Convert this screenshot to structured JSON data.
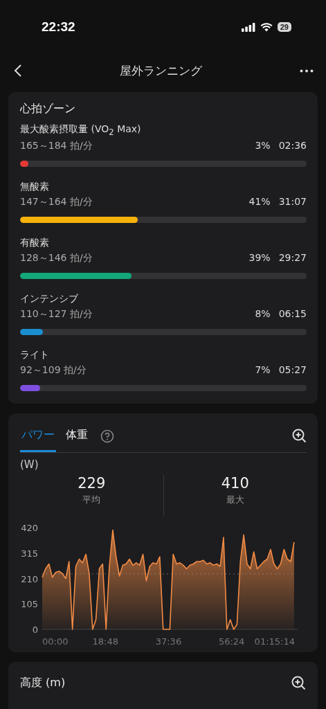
{
  "status_bar": {
    "time": "22:32",
    "battery": "29"
  },
  "nav": {
    "title": "屋外ランニング"
  },
  "heart_zones": {
    "title": "心拍ゾーン",
    "zones": [
      {
        "name": "最大酸素摂取量 (VO$_{2}$ Max)",
        "range": "165～184 拍/分",
        "percent": "3%",
        "time": "02:36",
        "level": 0.03,
        "color": "#e53935"
      },
      {
        "name": "無酸素",
        "range": "147～164 拍/分",
        "percent": "41%",
        "time": "31:07",
        "level": 0.41,
        "color": "#f6b10a"
      },
      {
        "name": "有酸素",
        "range": "128～146 拍/分",
        "percent": "39%",
        "time": "29:27",
        "level": 0.39,
        "color": "#12a77a"
      },
      {
        "name": "インテンシブ",
        "range": "110～127 拍/分",
        "percent": "8%",
        "time": "06:15",
        "level": 0.08,
        "color": "#1a8fd0"
      },
      {
        "name": "ライト",
        "range": "92～109 拍/分",
        "percent": "7%",
        "time": "05:27",
        "level": 0.07,
        "color": "#7e4fe0"
      }
    ]
  },
  "power": {
    "tabs": [
      {
        "label": "パワー",
        "selected": true
      },
      {
        "label": "体重",
        "selected": false
      }
    ],
    "unit": "(W)",
    "stats": [
      {
        "value": "229",
        "label": "平均"
      },
      {
        "value": "410",
        "label": "最大"
      }
    ],
    "chart_data": {
      "type": "area",
      "ylim": [
        0,
        420
      ],
      "yticks": [
        0,
        105,
        210,
        315,
        420
      ],
      "xlim": [
        0,
        75.23
      ],
      "xticks": [
        {
          "value": 0,
          "label": "00:00"
        },
        {
          "value": 18.8,
          "label": "18:48"
        },
        {
          "value": 37.6,
          "label": "37:36"
        },
        {
          "value": 56.4,
          "label": "56:24"
        },
        {
          "value": 75.23,
          "label": "01:15:14"
        }
      ],
      "x": [
        0,
        1,
        2,
        3,
        4,
        5,
        6,
        7,
        8,
        9,
        10,
        11,
        12,
        13,
        14,
        15,
        16,
        17,
        18,
        19,
        20,
        21,
        22,
        23,
        24,
        25,
        26,
        27,
        28,
        29,
        30,
        31,
        32,
        33,
        34,
        35,
        36,
        37,
        38,
        39,
        40,
        41,
        42,
        43,
        44,
        45,
        46,
        47,
        48,
        49,
        50,
        51,
        52,
        53,
        54,
        55,
        56,
        57,
        58,
        59,
        60,
        61,
        62,
        63,
        64,
        65,
        66,
        67,
        68,
        69,
        70,
        71,
        72,
        73,
        74,
        75
      ],
      "ref_lines": [
        {
          "axis": "y",
          "value": 229
        }
      ],
      "series": [
        {
          "color": "#f28b45",
          "values": [
            215,
            250,
            270,
            215,
            235,
            240,
            230,
            210,
            280,
            0,
            260,
            290,
            275,
            310,
            230,
            0,
            40,
            250,
            270,
            0,
            260,
            410,
            300,
            220,
            265,
            270,
            290,
            265,
            275,
            265,
            310,
            200,
            260,
            275,
            270,
            300,
            0,
            0,
            0,
            310,
            270,
            275,
            265,
            250,
            265,
            270,
            280,
            280,
            285,
            270,
            275,
            265,
            270,
            260,
            380,
            0,
            40,
            0,
            20,
            280,
            390,
            270,
            250,
            320,
            250,
            265,
            280,
            290,
            330,
            270,
            250,
            270,
            330,
            290,
            280,
            360
          ]
        }
      ]
    }
  },
  "altitude": {
    "title": "高度 (m)"
  }
}
